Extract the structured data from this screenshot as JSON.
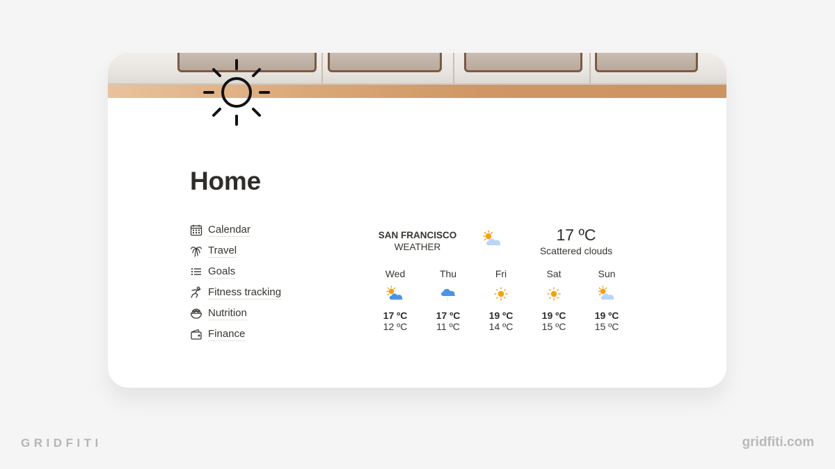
{
  "page": {
    "title": "Home",
    "page_icon": "sun-icon",
    "cover_image": "vintage-van-cover"
  },
  "nav": {
    "items": [
      {
        "label": "Calendar",
        "icon": "calendar-icon"
      },
      {
        "label": "Travel",
        "icon": "palm-tree-icon"
      },
      {
        "label": "Goals",
        "icon": "list-icon"
      },
      {
        "label": "Fitness tracking",
        "icon": "runner-icon"
      },
      {
        "label": "Nutrition",
        "icon": "salad-bowl-icon"
      },
      {
        "label": "Finance",
        "icon": "wallet-icon"
      }
    ]
  },
  "weather": {
    "city": "SAN FRANCISCO",
    "subtitle": "WEATHER",
    "current_icon": "partly-cloudy-icon",
    "current_temp": "17 ºC",
    "current_desc": "Scattered clouds",
    "forecast": [
      {
        "day": "Wed",
        "icon": "partly-cloudy-icon",
        "high": "17 ºC",
        "low": "12 ºC"
      },
      {
        "day": "Thu",
        "icon": "rain-cloud-icon",
        "high": "17 ºC",
        "low": "11 ºC"
      },
      {
        "day": "Fri",
        "icon": "sun-icon",
        "high": "19 ºC",
        "low": "14 ºC"
      },
      {
        "day": "Sat",
        "icon": "sun-icon",
        "high": "19 ºC",
        "low": "15 ºC"
      },
      {
        "day": "Sun",
        "icon": "partly-cloudy-light-icon",
        "high": "19 ºC",
        "low": "15 ºC"
      }
    ],
    "colors": {
      "sun": "#f5a00f",
      "cloud_dark": "#4a94e6",
      "cloud_light": "#b9d6f7"
    }
  },
  "branding": {
    "left": "GRIDFITI",
    "right": "gridfiti.com"
  }
}
